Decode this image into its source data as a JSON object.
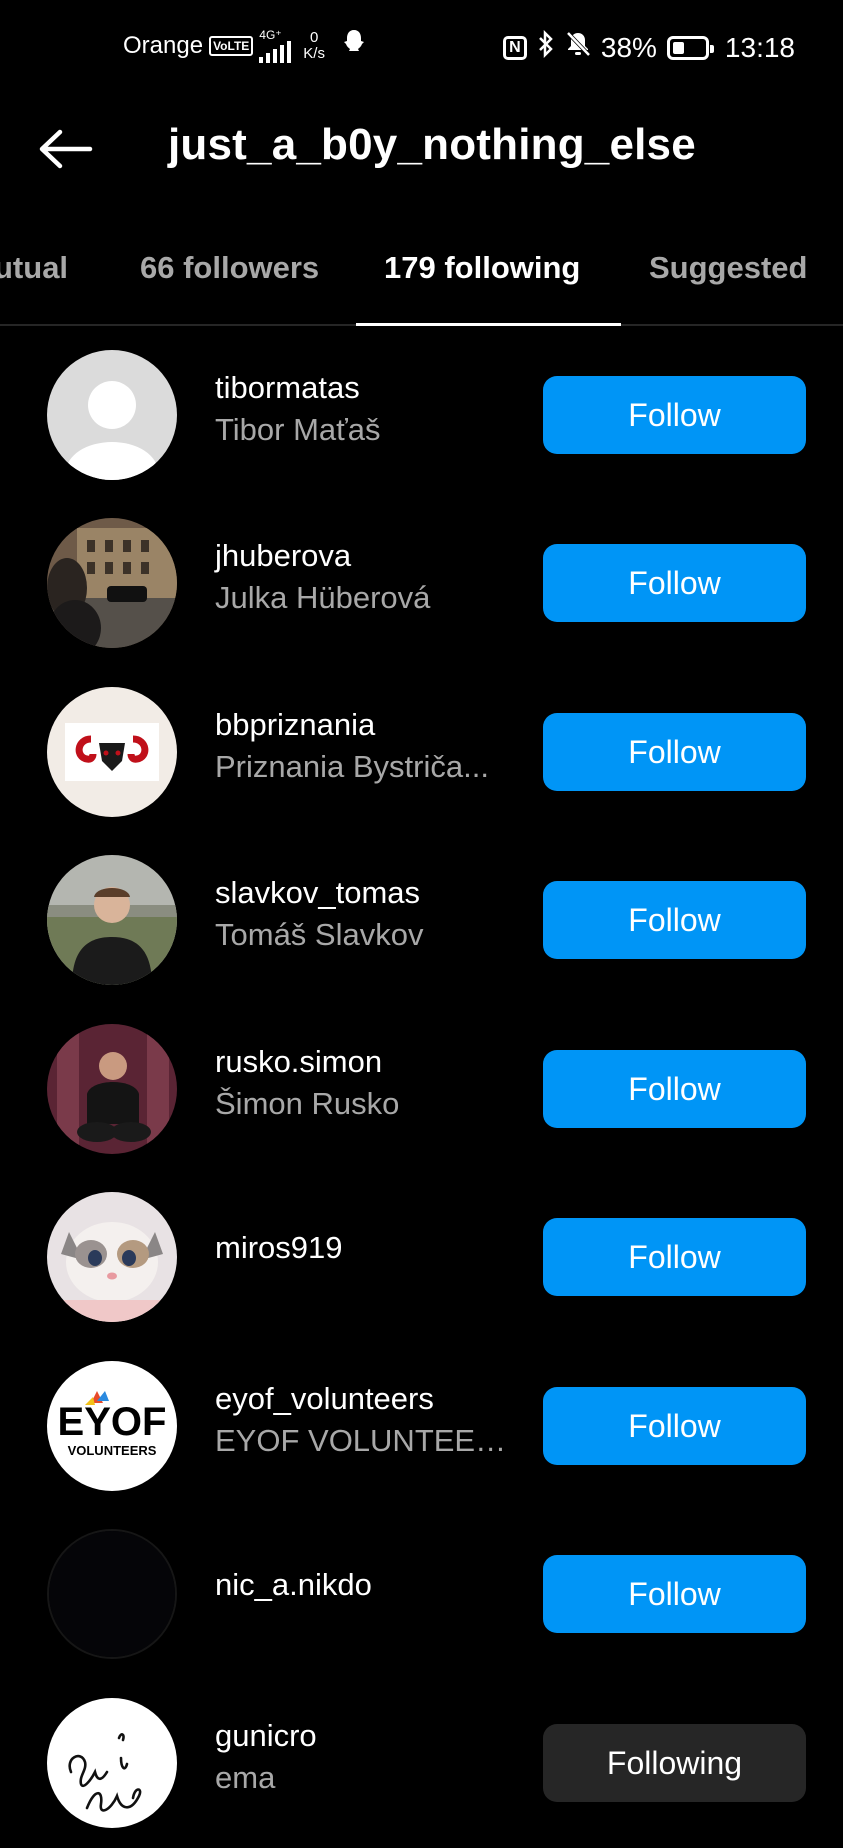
{
  "status_bar": {
    "carrier": "Orange",
    "volte": "VoLTE",
    "network": "4G⁺",
    "speed_value": "0",
    "speed_unit": "K/s",
    "battery_percent": "38%",
    "battery_level": 0.38,
    "time": "13:18"
  },
  "header": {
    "title": "just_a_b0y_nothing_else"
  },
  "tabs": [
    {
      "label": "utual",
      "active": false
    },
    {
      "label": "66 followers",
      "active": false
    },
    {
      "label": "179 following",
      "active": true
    },
    {
      "label": "Suggested",
      "active": false
    }
  ],
  "accounts": [
    {
      "username": "tibormatas",
      "fullname": "Tibor Maťaš",
      "button": "Follow",
      "state": "follow"
    },
    {
      "username": "jhuberova",
      "fullname": "Julka Hüberová",
      "button": "Follow",
      "state": "follow"
    },
    {
      "username": "bbpriznania",
      "fullname": "Priznania Bystriča...",
      "button": "Follow",
      "state": "follow"
    },
    {
      "username": "slavkov_tomas",
      "fullname": "Tomáš Slavkov",
      "button": "Follow",
      "state": "follow"
    },
    {
      "username": "rusko.simon",
      "fullname": "Šimon Rusko",
      "button": "Follow",
      "state": "follow"
    },
    {
      "username": "miros919",
      "fullname": "",
      "button": "Follow",
      "state": "follow"
    },
    {
      "username": "eyof_volunteers",
      "fullname": "EYOF VOLUNTEERS",
      "button": "Follow",
      "state": "follow"
    },
    {
      "username": "nic_a.nikdo",
      "fullname": "",
      "button": "Follow",
      "state": "follow"
    },
    {
      "username": "gunicro",
      "fullname": "ema",
      "button": "Following",
      "state": "following"
    }
  ],
  "avatar_art": {
    "eyof_logo_text": "EYOF",
    "eyof_logo_sub": "VOLUNTEERS"
  },
  "colors": {
    "background": "#000000",
    "follow_button": "#0095f6",
    "following_button": "#262626",
    "secondary_text": "#a8a8a8"
  }
}
